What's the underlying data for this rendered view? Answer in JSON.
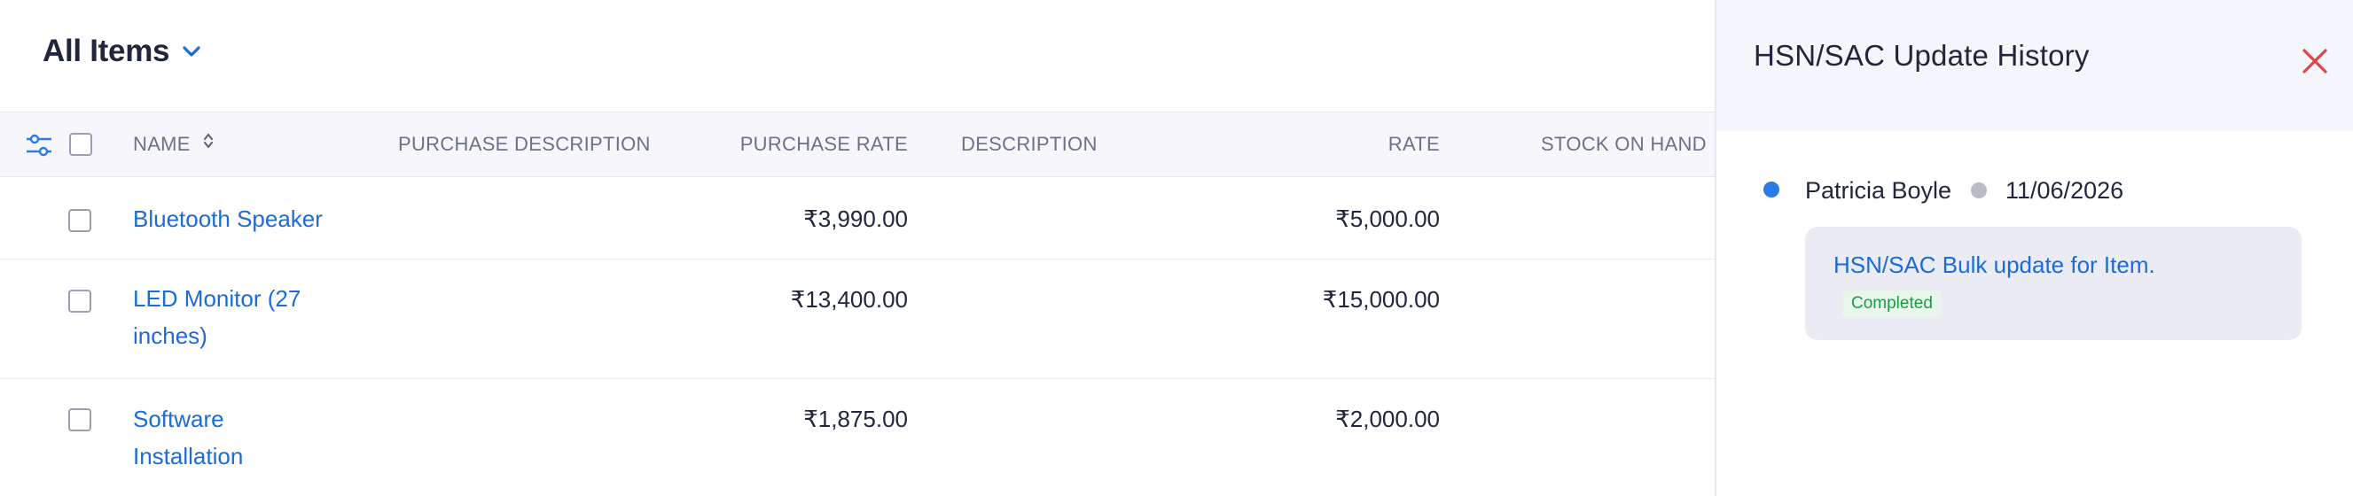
{
  "header": {
    "view_title": "All Items"
  },
  "table": {
    "columns": {
      "name": "NAME",
      "purchase_description": "PURCHASE DESCRIPTION",
      "purchase_rate": "PURCHASE RATE",
      "description": "DESCRIPTION",
      "rate": "RATE",
      "stock_on_hand": "STOCK ON HAND"
    },
    "rows": [
      {
        "name": "Bluetooth Speaker",
        "purchase_rate": "₹3,990.00",
        "rate": "₹5,000.00"
      },
      {
        "name": "LED Monitor (27 inches)",
        "purchase_rate": "₹13,400.00",
        "rate": "₹15,000.00"
      },
      {
        "name": "Software Installation",
        "purchase_rate": "₹1,875.00",
        "rate": "₹2,000.00"
      }
    ]
  },
  "panel": {
    "title": "HSN/SAC Update History",
    "entries": [
      {
        "user": "Patricia Boyle",
        "date": "11/06/2026",
        "action": "HSN/SAC Bulk update for Item.",
        "status": "Completed"
      }
    ]
  },
  "colors": {
    "link": "#1c6bd6",
    "close": "#e04545",
    "status_green": "#1a9c47",
    "timeline_dot": "#2a7be4"
  },
  "icons": {
    "view_dropdown": "chevron-down-icon",
    "column_filter": "sliders-icon",
    "sort": "sort-icon",
    "close": "close-icon"
  }
}
